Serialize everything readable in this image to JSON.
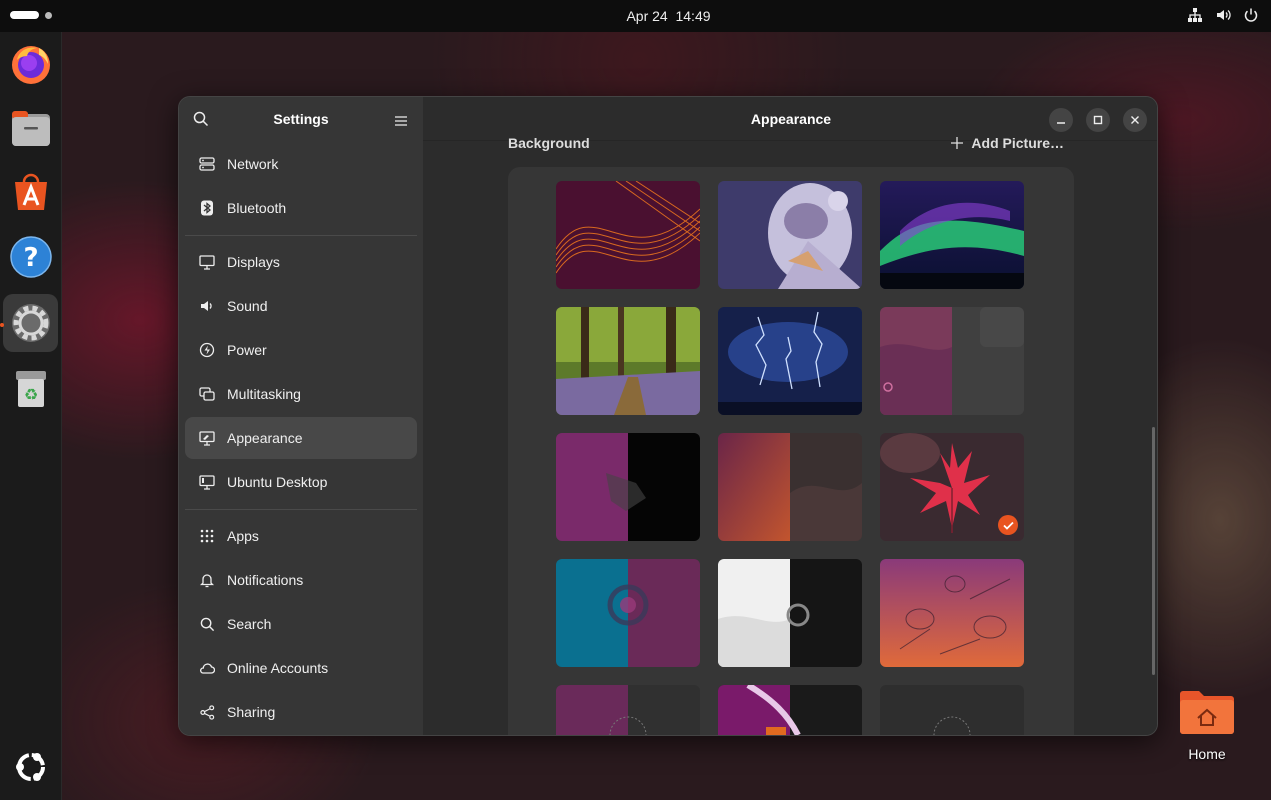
{
  "topbar": {
    "date": "Apr 24",
    "time": "14:49",
    "tray_icons": [
      "network-icon",
      "volume-icon",
      "power-icon"
    ]
  },
  "dock": {
    "apps": [
      {
        "name": "firefox-icon"
      },
      {
        "name": "files-icon"
      },
      {
        "name": "app-center-icon"
      },
      {
        "name": "help-icon"
      },
      {
        "name": "settings-icon",
        "active": true
      },
      {
        "name": "trash-icon"
      },
      {
        "name": "ubuntu-show-apps-icon"
      }
    ]
  },
  "window": {
    "sidebar_title": "Settings",
    "content_title": "Appearance",
    "nav": [
      {
        "label": "Network",
        "icon": "network-icon"
      },
      {
        "label": "Bluetooth",
        "icon": "bluetooth-icon"
      },
      {
        "label": "Displays",
        "icon": "display-icon"
      },
      {
        "label": "Sound",
        "icon": "speaker-icon"
      },
      {
        "label": "Power",
        "icon": "power-icon"
      },
      {
        "label": "Multitasking",
        "icon": "multitasking-icon"
      },
      {
        "label": "Appearance",
        "icon": "appearance-icon",
        "selected": true
      },
      {
        "label": "Ubuntu Desktop",
        "icon": "ubuntu-desktop-icon"
      },
      {
        "label": "Apps",
        "icon": "apps-grid-icon"
      },
      {
        "label": "Notifications",
        "icon": "bell-icon"
      },
      {
        "label": "Search",
        "icon": "search-icon"
      },
      {
        "label": "Online Accounts",
        "icon": "cloud-icon"
      },
      {
        "label": "Sharing",
        "icon": "share-icon"
      }
    ],
    "background": {
      "section_label": "Background",
      "add_picture_label": "Add Picture…",
      "wallpapers": [
        {
          "name": "orange-waves"
        },
        {
          "name": "raccoon-illustration"
        },
        {
          "name": "aurora"
        },
        {
          "name": "bluebell-forest"
        },
        {
          "name": "lightning-storm"
        },
        {
          "name": "ubuntu-purple-abstract"
        },
        {
          "name": "numbat-purple-black"
        },
        {
          "name": "numbat-red-dark"
        },
        {
          "name": "red-maple-leaves",
          "selected": true
        },
        {
          "name": "ubuntu-teal-purple"
        },
        {
          "name": "ubuntu-white-black"
        },
        {
          "name": "raccoon-orange"
        },
        {
          "name": "numbat-dark-1"
        },
        {
          "name": "numbat-purple-2"
        },
        {
          "name": "numbat-dark-2"
        }
      ]
    }
  },
  "desktop": {
    "home_label": "Home"
  },
  "colors": {
    "accent": "#e95420",
    "topbar": "#0d0d0d",
    "dock": "#1b1b1b",
    "sidebar": "#363636",
    "content": "#2c2c2c"
  }
}
